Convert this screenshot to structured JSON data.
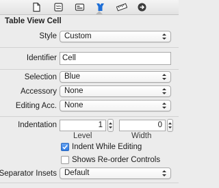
{
  "toolbar": {
    "icons": [
      "file-icon",
      "quick-help-icon",
      "identity-icon",
      "attributes-icon",
      "size-ruler-icon",
      "connections-icon"
    ],
    "selected": "attributes-icon"
  },
  "section": {
    "title": "Table View Cell"
  },
  "fields": {
    "style": {
      "label": "Style",
      "value": "Custom"
    },
    "identifier": {
      "label": "Identifier",
      "value": "Cell"
    },
    "selection": {
      "label": "Selection",
      "value": "Blue"
    },
    "accessory": {
      "label": "Accessory",
      "value": "None"
    },
    "editing_accessory": {
      "label": "Editing Acc.",
      "value": "None"
    },
    "indentation": {
      "label": "Indentation",
      "level": {
        "value": "1",
        "label": "Level"
      },
      "width": {
        "value": "0",
        "label": "Width"
      }
    },
    "indent_while_editing": {
      "label": "Indent While Editing",
      "checked": true
    },
    "shows_reorder_controls": {
      "label": "Shows Re-order Controls",
      "checked": false
    },
    "separator_insets": {
      "label": "Separator Insets",
      "value": "Default"
    }
  },
  "colors": {
    "accent": "#2f7be2",
    "selected_icon": "#1f6fd6",
    "icon": "#3c3c3c"
  }
}
